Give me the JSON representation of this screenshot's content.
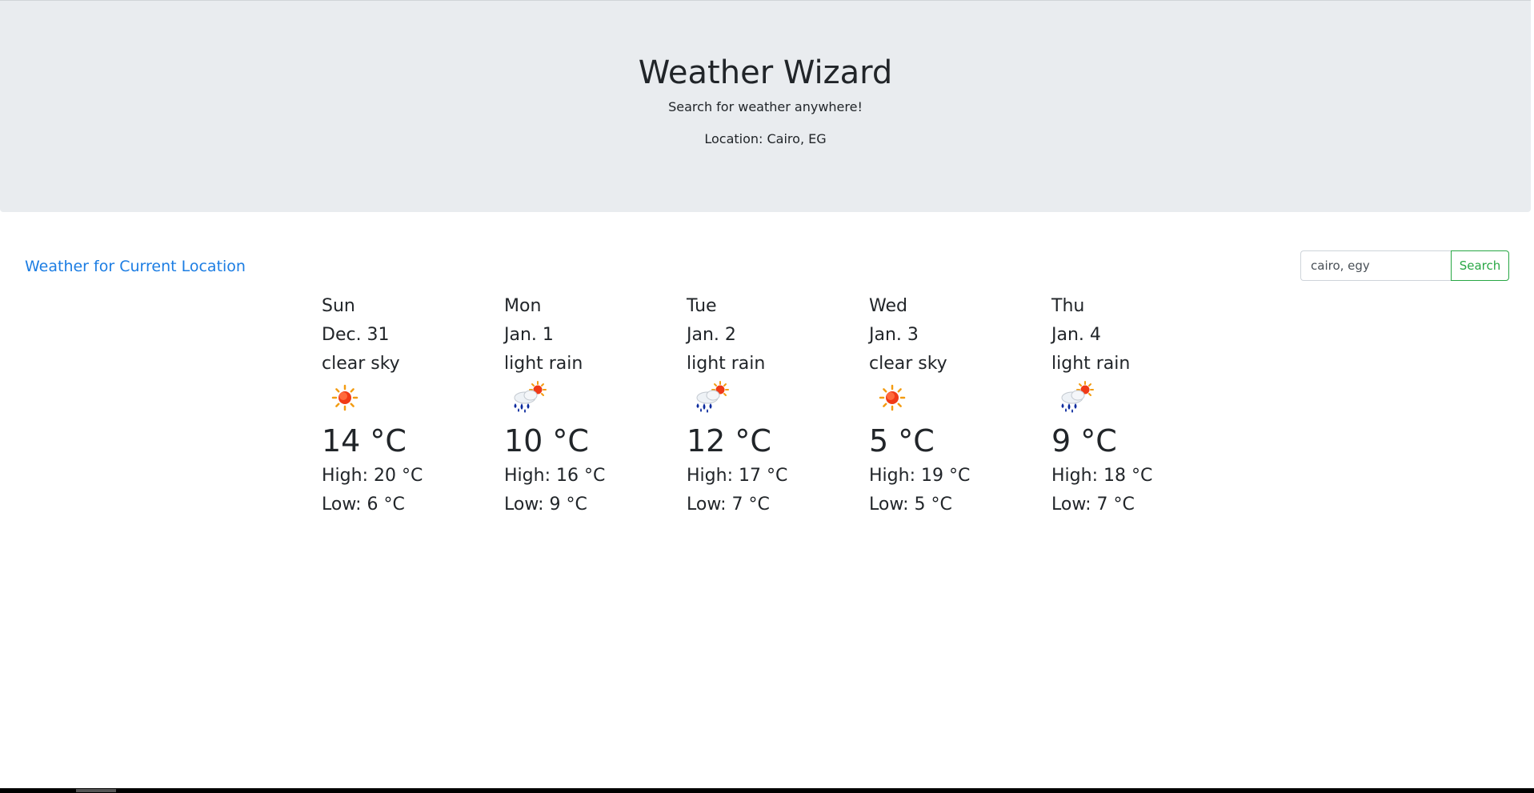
{
  "header": {
    "title": "Weather Wizard",
    "subtitle": "Search for weather anywhere!",
    "location": "Location: Cairo, EG"
  },
  "current_location_link": "Weather for Current Location",
  "search": {
    "value": "cairo, egy",
    "button_label": "Search"
  },
  "colors": {
    "jumbotron": "#e9ecef",
    "link": "#1c7de3",
    "search_button": "#28a745",
    "text": "#212529"
  },
  "forecast": [
    {
      "day": "Sun",
      "date": "Dec. 31",
      "description": "clear sky",
      "icon": "sun-icon",
      "temp": "14 °C",
      "high": "High: 20 °C",
      "low": "Low: 6 °C"
    },
    {
      "day": "Mon",
      "date": "Jan. 1",
      "description": "light rain",
      "icon": "rain-sun-icon",
      "temp": "10 °C",
      "high": "High: 16 °C",
      "low": "Low: 9 °C"
    },
    {
      "day": "Tue",
      "date": "Jan. 2",
      "description": "light rain",
      "icon": "rain-sun-icon",
      "temp": "12 °C",
      "high": "High: 17 °C",
      "low": "Low: 7 °C"
    },
    {
      "day": "Wed",
      "date": "Jan. 3",
      "description": "clear sky",
      "icon": "sun-icon",
      "temp": "5 °C",
      "high": "High: 19 °C",
      "low": "Low: 5 °C"
    },
    {
      "day": "Thu",
      "date": "Jan. 4",
      "description": "light rain",
      "icon": "rain-sun-icon",
      "temp": "9 °C",
      "high": "High: 18 °C",
      "low": "Low: 7 °C"
    }
  ]
}
